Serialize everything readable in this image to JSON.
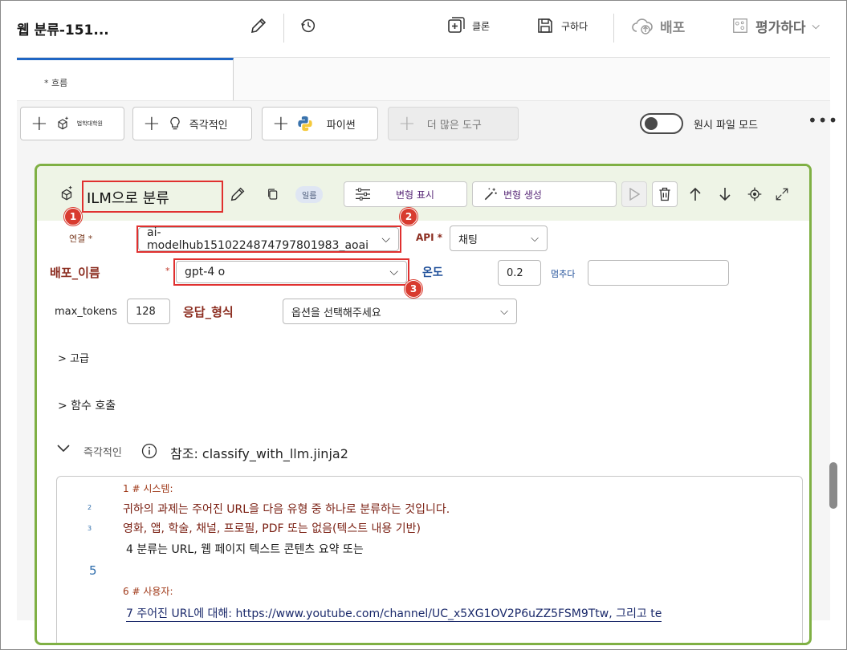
{
  "header": {
    "title": "웹 분류-151...",
    "clone_label": "클론",
    "save_label": "구하다",
    "deploy_label": "배포",
    "evaluate_label": "평가하다"
  },
  "tabs": [
    {
      "label": "* 흐름"
    }
  ],
  "toolbar": {
    "llm_label": "법학대학원",
    "prompt_label": "즉각적인",
    "python_label": "파이썬",
    "more_tools_label": "더 많은 도구",
    "raw_mode_label": "원시 파일 모드",
    "raw_mode_on": false
  },
  "node": {
    "title": "ILM으로 분류",
    "chip": "일름",
    "show_variants_label": "변형 표시",
    "generate_variants_label": "변형 생성",
    "connection_label": "연결 *",
    "connection_value": "ai-modelhub1510224874797801983_aoai",
    "api_label": "API *",
    "api_value": "채팅",
    "deployment_label": "배포_이름",
    "deployment_star": "*",
    "deployment_value": "gpt-4 o",
    "temperature_label": "온도",
    "temperature_value": "0.2",
    "stop_label": "멈추다",
    "stop_value": "",
    "max_tokens_label": "max_tokens",
    "max_tokens_value": "128",
    "response_format_label": "응답_형식",
    "response_format_placeholder": "옵션을 선택해주세요",
    "advanced_label": "> 고급",
    "function_call_label": "> 함수 호출",
    "prompt_section_label": "즉각적인",
    "prompt_ref": "참조: classify_with_llm.jinja2",
    "badges": [
      "1",
      "2",
      "3"
    ]
  },
  "editor": {
    "lines": [
      {
        "num": "",
        "text": "1 # 시스템:"
      },
      {
        "num": "2",
        "text": "귀하의 과제는 주어진 URL을 다음 유형 중 하나로 분류하는 것입니다."
      },
      {
        "num": "3",
        "text": "영화, 앱, 학술, 채널, 프로필, PDF 또는 없음(텍스트 내용 기반)"
      },
      {
        "num": "",
        "text": "4 분류는 URL, 웹 페이지 텍스트 콘텐츠 요약 또는"
      },
      {
        "num": "5",
        "text": ""
      },
      {
        "num": "",
        "text": "6 # 사용자:"
      },
      {
        "num": "",
        "text": "7 주어진 URL에 대해: https://www.youtube.com/channel/UC_x5XG1OV2P6uZZ5FSM9Ttw, 그리고 te"
      }
    ]
  },
  "colors": {
    "accent_green": "#7fb044",
    "highlight_red": "#e0302f",
    "tab_blue": "#1f66c4"
  }
}
